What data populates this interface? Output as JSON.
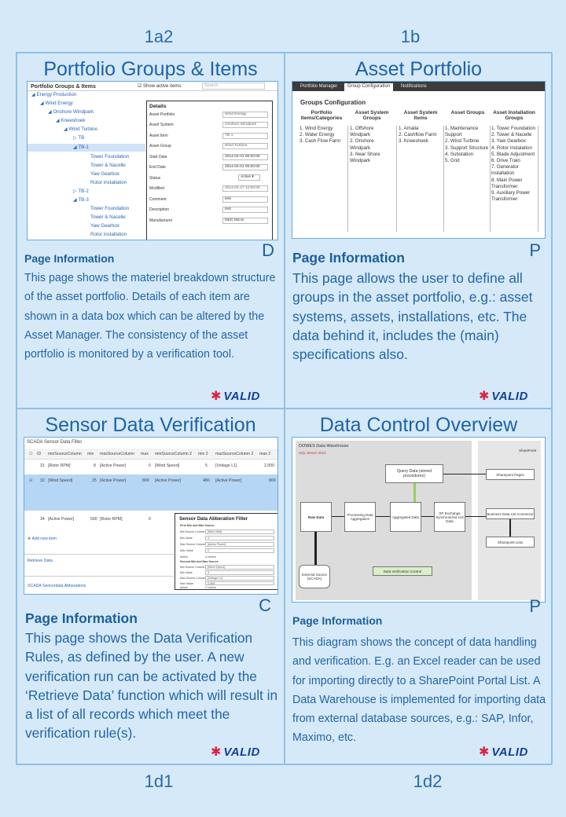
{
  "labels": {
    "top_left": "1a2",
    "top_right": "1b",
    "bottom_left": "1d1",
    "bottom_right": "1d2"
  },
  "panels": {
    "p1": {
      "title": "Portfolio Groups & Items",
      "corner": "D",
      "info_heading": "Page Information",
      "info_text": "This page shows the materiel breakdown structure of the asset portfolio. Details of each item are shown in a data box which can be altered by the Asset Manager. The consistency of the asset portfolio is monitored by a verification tool.",
      "logo": "VALID",
      "screen": {
        "header": "Portfolio Groups & Items",
        "checkbox_label": "Show active items",
        "search_placeholder": "Search",
        "tree": [
          "Energy Production",
          "Wind Energy",
          "Onshore Windpark",
          "Kneeshoek",
          "Wind Turbine",
          "TB",
          "TB-1",
          "Tower Foundation",
          "Tower & Nacelle",
          "Yaw Gearbox",
          "Rotor installation",
          "TB-2",
          "TB-3",
          "Tower Foundation",
          "Tower & Nacelle",
          "Yaw Gearbox",
          "Rotor installation"
        ],
        "details_title": "Details",
        "details": [
          {
            "label": "Asset Portfolio",
            "value": "Wind Energy"
          },
          {
            "label": "Asset System",
            "value": "Onshore Windpark"
          },
          {
            "label": "Asset Item",
            "value": "TB-1"
          },
          {
            "label": "Asset Group",
            "value": "Wind Turbine"
          },
          {
            "label": "Start Date",
            "value": "2014-04-01 00:00:00"
          },
          {
            "label": "End Date",
            "value": "2014-04-01 00:00:00"
          },
          {
            "label": "Status",
            "value": "Active"
          },
          {
            "label": "Modified",
            "value": "2014-04-17 12:00:00"
          },
          {
            "label": "Comment",
            "value": "test"
          },
          {
            "label": "Description",
            "value": "test"
          },
          {
            "label": "Manufacturer",
            "value": "NEG Micon"
          }
        ]
      }
    },
    "p2": {
      "title": "Asset Portfolio",
      "corner": "P",
      "info_heading": "Page Information",
      "info_text": "This page allows the user to define all groups in the asset portfolio, e.g.: asset systems, assets, installations, etc. The data behind it, includes the (main) specifications also.",
      "logo": "VALID",
      "screen": {
        "tabs": [
          "Portfolio Manager",
          "Group Configuration",
          "Notifications"
        ],
        "heading": "Groups Configuration",
        "columns": [
          {
            "head": "Portfolio Items/Categories",
            "items": [
              "1. Wind Energy",
              "2. Water Energy",
              "3. Cash Flow Farm"
            ]
          },
          {
            "head": "Asset System Groups",
            "items": [
              "1. Offshore Windpark",
              "2. Onshore Windpark",
              "3. Near Shore Windpark"
            ]
          },
          {
            "head": "Asset System Items",
            "items": [
              "1. Amalia",
              "2. Cashflow Farm",
              "3. Kneeshoek"
            ]
          },
          {
            "head": "Asset Groups",
            "items": [
              "1. Maintenance Support",
              "2. Wind Turbine",
              "3. Support Structure",
              "4. Substation",
              "5. Grid"
            ]
          },
          {
            "head": "Asset Installation Groups",
            "items": [
              "1. Tower Foundation",
              "2. Tower & Nacelle",
              "3. Yaw Gearbox",
              "4. Rotor Instalation",
              "5. Blade Adjustment",
              "6. Drive Train",
              "7. Generator installation",
              "8. Main Power Transformer",
              "9. Auxiliary Power Transformer"
            ]
          }
        ]
      }
    },
    "p3": {
      "title": "Sensor Data Verification",
      "corner": "C",
      "info_heading": "Page Information",
      "info_text": "This page shows the Data Verification Rules, as defined by the user. A new verification run can be activated by the ‘Retrieve Data’ function which will result in a list of all records which meet the verification rule(s).",
      "logo": "VALID",
      "screen": {
        "title": "SCADA Sensor Data Filter",
        "headers": [
          "ID",
          "minSourceColumn",
          "min",
          "maxSourceColumn",
          "max",
          "minSourceColumn 2",
          "min 2",
          "maxSourceColumn 2",
          "max 2"
        ],
        "rows": [
          [
            "31",
            "[Rotor RPM]",
            "8",
            "[Active Power]",
            "0",
            "[Wind Speed]",
            "5",
            "[Voltage L1]",
            "2,000"
          ],
          [
            "32",
            "[Wind Speed]",
            "25",
            "[Active Power]",
            "800",
            "[Active Power]",
            "480",
            "[Active Power]",
            "800"
          ],
          [
            "34",
            "[Active Power]",
            "500",
            "[Rotor RPM]",
            "0",
            "",
            "",
            "",
            ""
          ]
        ],
        "add_new": "Add new item",
        "retrieve": "Retrieve Data",
        "footer": "SCADA Sensordata Abberations",
        "filter_title": "Sensor Data Abberation Filter",
        "filter_section1": "First Min and Max Source",
        "filter_section2": "Second Min and Max Source",
        "filter_rows": [
          {
            "label": "Min Source Column",
            "value": "[Wind Wild]"
          },
          {
            "label": "Min Value",
            "value": "4"
          },
          {
            "label": "Max Source Column",
            "value": "[Active Power]"
          },
          {
            "label": "Max Value",
            "value": "0"
          },
          {
            "label": "Active",
            "value": "Active"
          },
          {
            "label": "Min Source Column",
            "value": "[Wind Speed]"
          },
          {
            "label": "Min Value",
            "value": "5"
          },
          {
            "label": "Max Source Column",
            "value": "[Voltage L1]"
          },
          {
            "label": "Max Value",
            "value": "2,000"
          },
          {
            "label": "Active",
            "value": "Active"
          }
        ]
      }
    },
    "p4": {
      "title": "Data Control Overview",
      "corner": "P",
      "info_heading": "Page Information",
      "info_text": "This diagram shows the concept of data handling and verification. E.g. an Excel reader can be used for importing directly to a SharePoint Portal List. A Data Warehouse is implemented for importing data from external database sources, e.g.: SAP, Infor, Maximo, etc.",
      "logo": "VALID",
      "screen": {
        "dw_title": "DOWES Data Warehouse",
        "sql_label": "SQL Server 2012",
        "sharepoint_label": "SharePoint",
        "boxes": {
          "raw": "Raw Data",
          "processing": "Processing Data Aggregation",
          "aggregated": "Aggregated Data",
          "sp_exchange": "SP Exchange Synchronized List Data",
          "query": "Query Data (stored procedures)",
          "sp_pages": "Sharepoint Pages",
          "bdc": "Business Data List Connector",
          "sp_lists": "Sharepoint Lists",
          "external": "External Source (SCADA)",
          "verify": "Data Verification Control"
        }
      }
    }
  }
}
